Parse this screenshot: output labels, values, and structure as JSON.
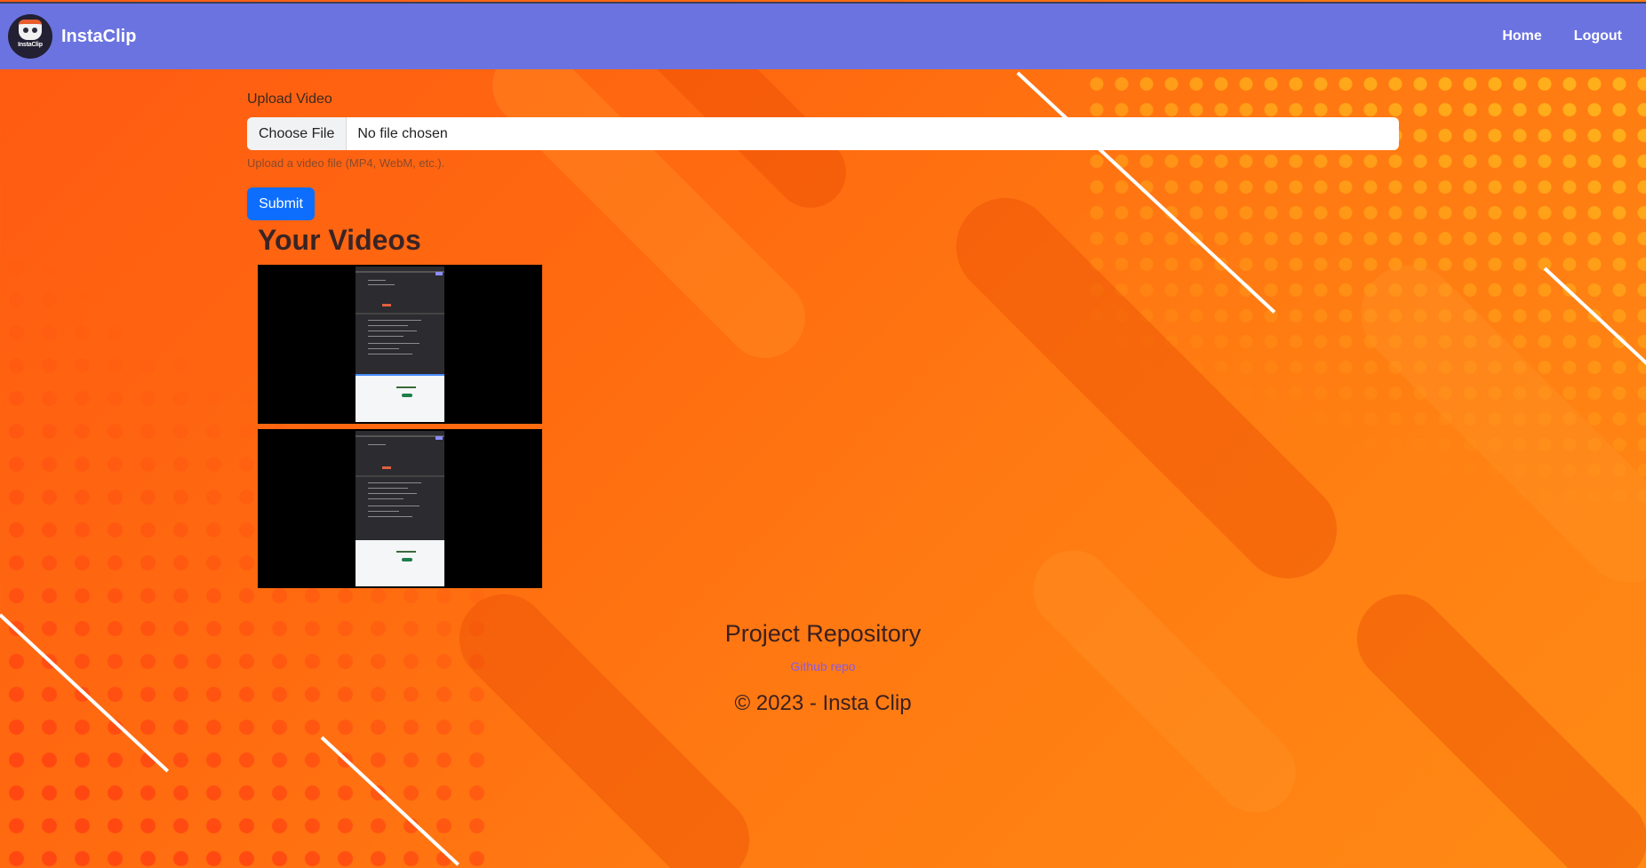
{
  "navbar": {
    "brand_name": "InstaClip",
    "logo_text": "InstaClip",
    "links": [
      "Home",
      "Logout"
    ]
  },
  "upload": {
    "label": "Upload Video",
    "choose_file_label": "Choose File",
    "file_status": "No file chosen",
    "help_text": "Upload a video file (MP4, WebM, etc.).",
    "submit_label": "Submit"
  },
  "videos": {
    "title": "Your Videos",
    "count": 2
  },
  "footer": {
    "repo_title": "Project Repository",
    "repo_link": "Github repo",
    "copyright": "© 2023 - Insta Clip"
  },
  "colors": {
    "navbar": "#6b73e0",
    "submit": "#0d6efd",
    "background": "#ff6a10"
  }
}
